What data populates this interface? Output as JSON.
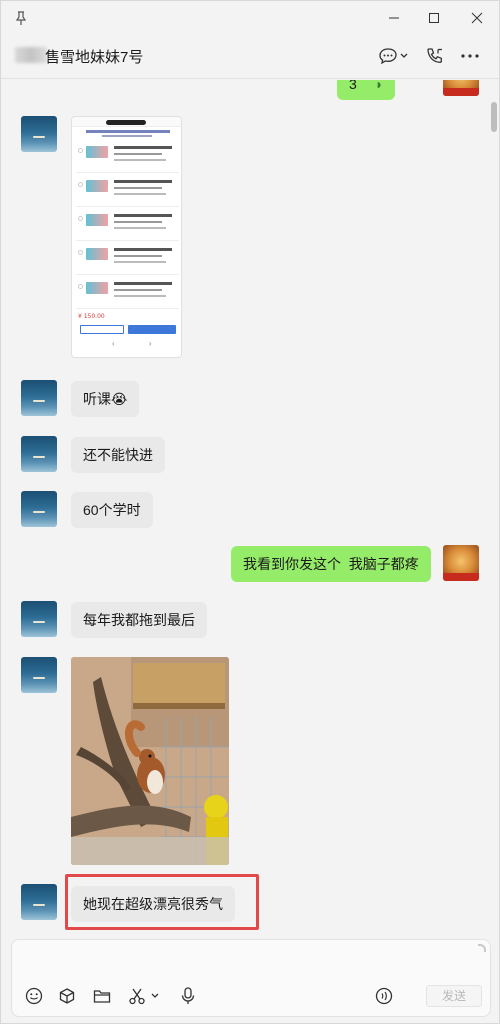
{
  "chat": {
    "title": "售雪地妹妹7号",
    "send_label": "发送"
  },
  "messages": {
    "m1": "听课😭",
    "m2": "还不能快进",
    "m3": "60个学时",
    "m4": "我看到你发这个  我脑子都疼",
    "m5": "每年我都拖到最后",
    "m6": "她现在超级漂亮很秀气",
    "partial_top": "3"
  },
  "screenshot_msg": {
    "price": "¥ 150.00",
    "nav": "‹ ›"
  },
  "colors": {
    "my_bubble": "#95ec69",
    "their_bubble": "#e9e9e9",
    "highlight": "#e24a4a"
  },
  "icons": [
    "pin-icon",
    "minimize-icon",
    "maximize-icon",
    "close-icon",
    "chat-bubble-icon",
    "chevron-down-icon",
    "call-icon",
    "more-icon",
    "emoji-icon",
    "package-icon",
    "folder-icon",
    "scissors-icon",
    "microphone-icon",
    "voice-to-text-icon"
  ]
}
